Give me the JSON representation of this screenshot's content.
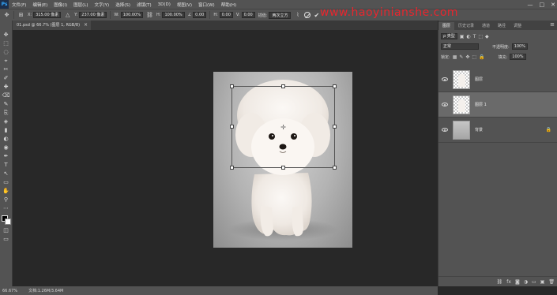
{
  "app": {
    "logo": "Ps"
  },
  "menu": [
    "文件(F)",
    "编辑(E)",
    "图像(I)",
    "图层(L)",
    "文字(Y)",
    "选择(S)",
    "滤镜(T)",
    "3D(D)",
    "视图(V)",
    "窗口(W)",
    "帮助(H)"
  ],
  "window_controls": {
    "minimize": "—",
    "maximize": "□",
    "close": "✕"
  },
  "options": {
    "x_label": "X:",
    "x_value": "315.00 像素",
    "y_label": "Y:",
    "y_value": "237.00 像素",
    "w_label": "W:",
    "w_value": "100.00%",
    "h_label": "H:",
    "h_value": "100.00%",
    "angle_value": "0.00",
    "hskew_label": "H:",
    "hskew_value": "0.00",
    "vskew_label": "V:",
    "vskew_value": "0.00",
    "interp_label": "插值:",
    "interp_value": "两次立方"
  },
  "watermark": "www.haoyinianshe.com",
  "document_tab": {
    "title": "01.psd @ 66.7% (图层 1, RGB/8)",
    "close": "×"
  },
  "tools": [
    "✥",
    "⬚",
    "◌",
    "⌖",
    "✂",
    "✐",
    "✚",
    "⌫",
    "✎",
    "⎘",
    "◈",
    "▮",
    "◐",
    "◉",
    "✒",
    "T",
    "↖",
    "▭",
    "✋",
    "⚲",
    "⋯"
  ],
  "statusbar": {
    "zoom": "66.67%",
    "doc_info": "文档:1.26M/3.64M"
  },
  "panel": {
    "tabs": [
      "图层",
      "历史记录",
      "通道",
      "路径",
      "调整"
    ],
    "active_tab": 0,
    "menu_icon": "≡",
    "filter_label": "ρ 类型",
    "filter_icons": [
      "▣",
      "◐",
      "T",
      "⬚",
      "◆"
    ],
    "blend_mode": "正常",
    "opacity_label": "不透明度:",
    "opacity_value": "100%",
    "lock_label": "锁定:",
    "lock_icons": [
      "▦",
      "✎",
      "✥",
      "⬚",
      "🔒"
    ],
    "fill_label": "填充:",
    "fill_value": "100%",
    "layers": [
      {
        "name": "图层",
        "selected": false,
        "thumb": "dog-checker"
      },
      {
        "name": "图层 1",
        "selected": true,
        "thumb": "dog-checker"
      },
      {
        "name": "背景",
        "selected": false,
        "thumb": "gray",
        "locked": true,
        "lock_icon": "🔒"
      }
    ],
    "footer_icons": [
      "⛓",
      "fx",
      "◙",
      "◑",
      "▭",
      "▣",
      "🗑"
    ]
  }
}
